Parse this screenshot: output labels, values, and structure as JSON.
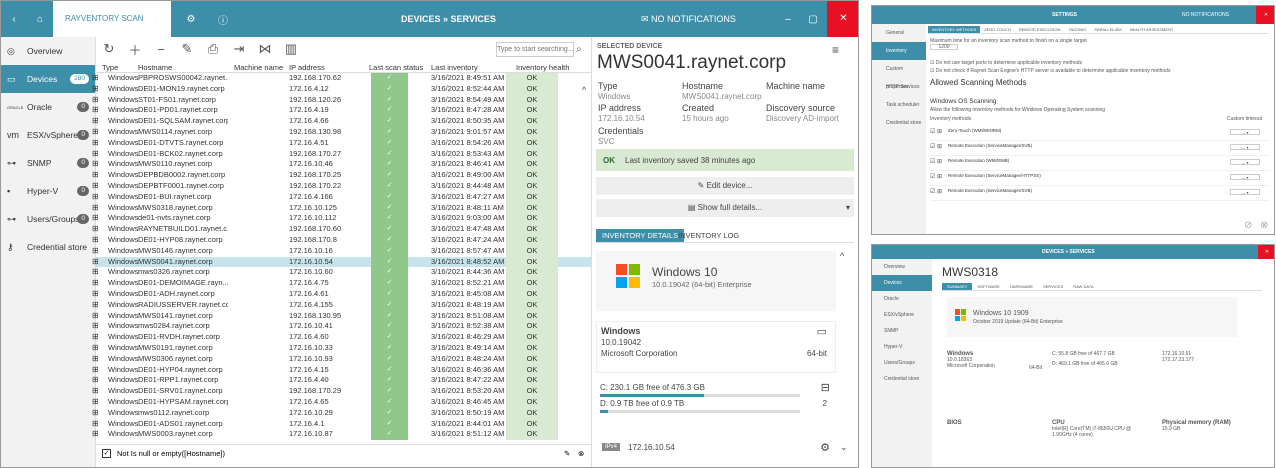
{
  "main": {
    "titlebar": {
      "app_name": "RAYVENTORY SCAN ENGINE",
      "section": "DEVICES » SERVICES",
      "notifications": "NO NOTIFICATIONS"
    },
    "sidebar": [
      {
        "label": "Overview",
        "count": "",
        "icon": "overview-icon",
        "glyph": "◎"
      },
      {
        "label": "Devices",
        "count": "280",
        "icon": "devices-icon",
        "glyph": "▭"
      },
      {
        "label": "Oracle",
        "count": "0",
        "icon": "oracle-icon",
        "glyph": "ORACLE"
      },
      {
        "label": "ESX/vSphere",
        "count": "0",
        "icon": "vmware-icon",
        "glyph": "vm"
      },
      {
        "label": "SNMP",
        "count": "0",
        "icon": "snmp-icon",
        "glyph": "⊶"
      },
      {
        "label": "Hyper-V",
        "count": "0",
        "icon": "hyperv-icon",
        "glyph": "▪"
      },
      {
        "label": "Users/Groups",
        "count": "0",
        "icon": "users-icon",
        "glyph": "⊶"
      },
      {
        "label": "Credential store",
        "count": "",
        "icon": "key-icon",
        "glyph": "⚷"
      }
    ],
    "search_placeholder": "Type to start searching...",
    "columns": [
      "Type",
      "Hostname",
      "Machine name",
      "IP address",
      "Last scan status",
      "Last inventory",
      "Inventory health"
    ],
    "rows": [
      [
        "Windows",
        "PBPROSWS00042.raynet...",
        "",
        "192.168.170.62",
        "3/16/2021 8:49:51 AM",
        "OK"
      ],
      [
        "Windows",
        "DE01-MON19.raynet.corp",
        "",
        "172.16.4.12",
        "3/16/2021 8:52:44 AM",
        "OK"
      ],
      [
        "Windows",
        "ST01-FS01.raynet.corp",
        "",
        "192.168.120.26",
        "3/16/2021 8:54:49 AM",
        "OK"
      ],
      [
        "Windows",
        "DE01-PD01.raynet.corp",
        "",
        "172.16.4.19",
        "3/16/2021 8:47:28 AM",
        "OK"
      ],
      [
        "Windows",
        "DE01-SQLSAM.raynet.corp",
        "",
        "172.16.4.66",
        "3/16/2021 8:50:35 AM",
        "OK"
      ],
      [
        "Windows",
        "MWS0114.raynet.corp",
        "",
        "192.168.130.98",
        "3/16/2021 9:01:57 AM",
        "OK"
      ],
      [
        "Windows",
        "DE01-DTVTS.raynet.corp",
        "",
        "172.16.4.51",
        "3/16/2021 8:54:26 AM",
        "OK"
      ],
      [
        "Windows",
        "DE01-BCK02.raynet.corp",
        "",
        "192.168.170.27",
        "3/16/2021 8:53:43 AM",
        "OK"
      ],
      [
        "Windows",
        "MWS0110.raynet.corp",
        "",
        "172.16.10.46",
        "3/16/2021 8:46:41 AM",
        "OK"
      ],
      [
        "Windows",
        "DEPBDB0002.raynet.corp",
        "",
        "192.168.170.25",
        "3/16/2021 8:49:00 AM",
        "OK"
      ],
      [
        "Windows",
        "DEPBTF0001.raynet.corp",
        "",
        "192.168.170.22",
        "3/16/2021 8:44:48 AM",
        "OK"
      ],
      [
        "Windows",
        "DE01-BUI.raynet.corp",
        "",
        "172.16.4.166",
        "3/16/2021 8:47:27 AM",
        "OK"
      ],
      [
        "Windows",
        "MWS0318.raynet.corp",
        "",
        "172.16.10.125",
        "3/16/2021 8:48:11 AM",
        "OK"
      ],
      [
        "Windows",
        "de01-nvts.raynet.corp",
        "",
        "172.16.10.112",
        "3/16/2021 9:03:00 AM",
        "OK"
      ],
      [
        "Windows",
        "RAYNETBUILD01.raynet.c...",
        "",
        "192.168.170.60",
        "3/16/2021 8:47:48 AM",
        "OK"
      ],
      [
        "Windows",
        "DE01-HYP08.raynet.corp",
        "",
        "192.168.170.8",
        "3/16/2021 8:47:24 AM",
        "OK"
      ],
      [
        "Windows",
        "MWS0146.raynet.corp",
        "",
        "172.16.10.16",
        "3/16/2021 8:57:47 AM",
        "OK"
      ],
      [
        "Windows",
        "MWS0041.raynet.corp",
        "",
        "172.16.10.54",
        "3/16/2021 8:48:52 AM",
        "OK"
      ],
      [
        "Windows",
        "mws0326.raynet.corp",
        "",
        "172.16.10.60",
        "3/16/2021 8:44:36 AM",
        "OK"
      ],
      [
        "Windows",
        "DE01-DEMOIMAGE.rayn...",
        "",
        "172.16.4.75",
        "3/16/2021 8:52:21 AM",
        "OK"
      ],
      [
        "Windows",
        "DE01-ADH.raynet.corp",
        "",
        "172.16.4.61",
        "3/16/2021 8:45:08 AM",
        "OK"
      ],
      [
        "Windows",
        "RADIUSSERVER.raynet.co...",
        "",
        "172.16.4.155",
        "3/16/2021 8:48:19 AM",
        "OK"
      ],
      [
        "Windows",
        "MWS0141.raynet.corp",
        "",
        "192.168.130.95",
        "3/16/2021 8:51:08 AM",
        "OK"
      ],
      [
        "Windows",
        "mws0284.raynet.corp",
        "",
        "172.16.10.41",
        "3/16/2021 8:52:38 AM",
        "OK"
      ],
      [
        "Windows",
        "DE01-RVDH.raynet.corp",
        "",
        "172.16.4.60",
        "3/16/2021 8:46:29 AM",
        "OK"
      ],
      [
        "Windows",
        "MWS0191.raynet.corp",
        "",
        "172.16.10.33",
        "3/16/2021 8:49:14 AM",
        "OK"
      ],
      [
        "Windows",
        "MWS0306.raynet.corp",
        "",
        "172.16.10.93",
        "3/16/2021 8:48:24 AM",
        "OK"
      ],
      [
        "Windows",
        "DE01-HYP04.raynet.corp",
        "",
        "172.16.4.15",
        "3/16/2021 8:46:36 AM",
        "OK"
      ],
      [
        "Windows",
        "DE01-RPP1.raynet.corp",
        "",
        "172.16.4.40",
        "3/16/2021 8:47:22 AM",
        "OK"
      ],
      [
        "Windows",
        "DE01-SRV01.raynet.corp",
        "",
        "192.168.170.29",
        "3/16/2021 8:53:20 AM",
        "OK"
      ],
      [
        "Windows",
        "DE01-HYPSAM.raynet.corp",
        "",
        "172.16.4.65",
        "3/16/2021 8:46:45 AM",
        "OK"
      ],
      [
        "Windows",
        "mws0112.raynet.corp",
        "",
        "172.16.10.29",
        "3/16/2021 8:50:19 AM",
        "OK"
      ],
      [
        "Windows",
        "DE01-ADS01.raynet.corp",
        "",
        "172.16.4.1",
        "3/16/2021 8:44:01 AM",
        "OK"
      ],
      [
        "Windows",
        "MWS0003.raynet.corp",
        "",
        "172.16.10.87",
        "3/16/2021 8:51:12 AM",
        "OK"
      ]
    ],
    "selected_row": 17,
    "filter_text": "Not Is null or empty([Hostname])",
    "detail": {
      "header": "SELECTED DEVICE",
      "name": "MWS0041.raynet.corp",
      "labels": {
        "type": "Type",
        "hostname": "Hostname",
        "machine": "Machine name",
        "ip": "IP address",
        "created": "Created",
        "discovery": "Discovery source",
        "credentials": "Credentials"
      },
      "values": {
        "type": "Windows",
        "hostname": "MWS0041.raynet.corp",
        "ip": "172.16.10.54",
        "created": "15 hours ago",
        "discovery": "Discovery AD-import",
        "credentials": "SVC"
      },
      "status_badge": "OK",
      "status_text": "Last inventory saved 38 minutes ago",
      "edit_label": "Edit device...",
      "details_label": "Show full details...",
      "tabs": [
        "INVENTORY DETAILS",
        "INVENTORY LOG"
      ],
      "os_name": "Windows 10",
      "os_version": "10.0.19042 (64-bit) Enterprise",
      "sys_title": "Windows",
      "sys_version": "10.0.19042",
      "sys_vendor": "Microsoft Corporation",
      "sys_arch": "64-bit",
      "disk1": "C: 230.1 GB free of 476.3 GB",
      "disk2": "D: 0.9 TB free of 0.9 TB",
      "disk_count": "2",
      "disk1_fill": 0.52,
      "disk2_fill": 0.04,
      "net_badge": "IPv4",
      "net_ip": "172.16.10.54"
    }
  },
  "settings": {
    "title": "SETTINGS",
    "notifications": "NO NOTIFICATIONS",
    "tabs": [
      "INVENTORY METHODS",
      "ZERO-TOUCH",
      "REMOTE EXECUTION",
      "TAGGING",
      "PARALLELISM",
      "HEALTH ASSESSMENT"
    ],
    "nav": [
      "General",
      "Inventory",
      "Custom properties",
      "HTTP Services",
      "Task scheduler",
      "Credential store"
    ],
    "max_time_label": "Maximum time for an inventory scan method to finish on a single target",
    "max_time_value": "1200",
    "check1": "Do not use target ports to determine applicable inventory methods",
    "check2": "Do not check if Raynet Scan Engine's HTTP server is available to determine applicable inventory methods",
    "allowed_heading": "Allowed Scanning Methods",
    "os_heading": "Windows OS Scanning",
    "os_sub": "Allow the following inventory methods for Windows Operating System scanning",
    "col_method": "Inventory methods",
    "col_timeout": "Custom timeout",
    "methods": [
      "Zero-Touch (WMI/WINRM)",
      "Remote Execution (ServiceManager/SVB)",
      "Remote Execution (WMI/SMB)",
      "Remote Execution (ServiceManager/HTTPSS)",
      "Remote Execution (ServiceManager/SVB)"
    ]
  },
  "device": {
    "title": "DEVICES » SERVICES",
    "name": "MWS0318",
    "tabs": [
      "SUMMARY",
      "SOFTWARE",
      "HARDWARE",
      "SERVICES",
      "RAW DATA"
    ],
    "os": "Windows 10 1909",
    "os_sub": "October 2019 Update (64-Bit) Enterprise",
    "nav": [
      "Overview",
      "Devices",
      "Oracle",
      "ESX/vSphere",
      "SNMP",
      "Hyper-V",
      "Users/Groups",
      "Credential store"
    ],
    "win_title": "Windows",
    "win_ver": "10.0.18363",
    "win_vendor": "Microsoft Corporation",
    "win_arch": "64-Bit",
    "disk_c": "C: 55.8 GB free of 467.7 GB",
    "disk_d": "D: 469.1 GB free of 465.6 GB",
    "ip1": "172.16.10.61",
    "ip2": "172.17.23.177",
    "bios": "BIOS",
    "cpu": "CPU",
    "cpu_val": "Intel(R) Core(TM) i7-8650U CPU @ 1.90GHz (4 cores)",
    "ram": "Physical memory (RAM)",
    "ram_val": "15.9 GB"
  },
  "colors": {
    "brand": "#3d8ea8",
    "ok_green": "#d9ead3",
    "check_green": "#8fc88a",
    "close": "#e81123",
    "selected": "#c8e4ea"
  }
}
